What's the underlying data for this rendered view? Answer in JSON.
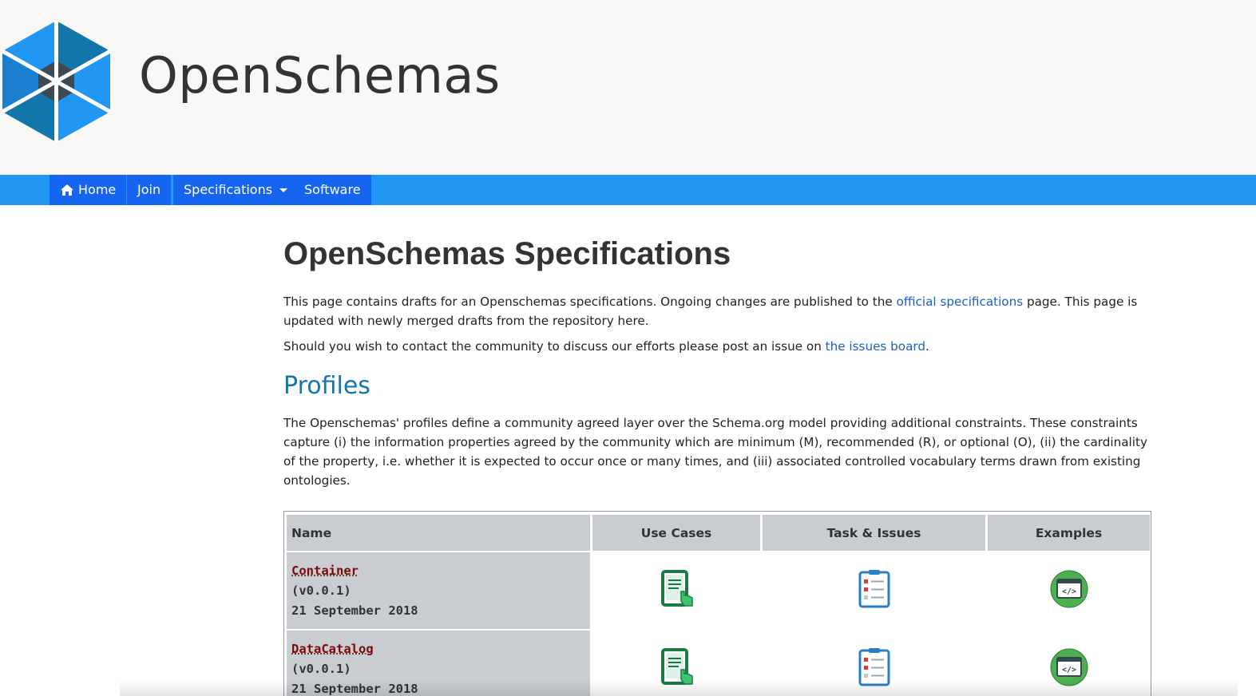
{
  "header": {
    "brand": "OpenSchemas",
    "logo_icon": "hexagon-logo-icon",
    "colors": {
      "background": "#f9f8f7",
      "logo_blue": "#2196f3",
      "logo_dark": "#1376ab"
    }
  },
  "nav": {
    "color": "#2196f3",
    "items": [
      {
        "label": "Home",
        "icon": "home-icon"
      },
      {
        "label": "Join"
      },
      {
        "label": "Specifications",
        "icon": "caret-down-icon"
      },
      {
        "label": "Software"
      }
    ]
  },
  "main": {
    "title": "OpenSchemas Specifications",
    "intro": {
      "text_before_link": "This page contains drafts for an Openschemas specifications. Ongoing changes are published to the ",
      "link_text": "official specifications",
      "text_after_link": " page. This page is updated with newly merged drafts from the repository here."
    },
    "contact": {
      "text_before_link": "Should you wish to contact the community to discuss our efforts please post an issue on ",
      "link_text": "the issues board",
      "text_after_link": "."
    },
    "profiles": {
      "title": "Profiles",
      "description": "The Openschemas' profiles define a community agreed layer over the Schema.org model providing additional constraints. These constraints capture (i) the information properties agreed by the community which are minimum (M), recommended (R), or optional (O), (ii) the cardinality of the property, i.e. whether it is expected to occur once or many times, and (iii) associated controlled vocabulary terms drawn from existing ontologies."
    }
  },
  "table": {
    "headers": [
      "Name",
      "Use Cases",
      "Task & Issues",
      "Examples"
    ],
    "rows": [
      {
        "name": "Container",
        "version": "(v0.0.1)",
        "date": "21 September 2018",
        "icons": [
          "use-cases-icon",
          "task-issues-icon",
          "examples-code-icon"
        ]
      },
      {
        "name": "DataCatalog",
        "version": "(v0.0.1)",
        "date": "21 September 2018",
        "icons": [
          "use-cases-icon",
          "task-issues-icon",
          "examples-code-icon"
        ]
      }
    ]
  }
}
